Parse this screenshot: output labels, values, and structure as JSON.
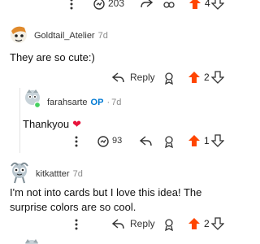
{
  "top_bar": {
    "views": "203",
    "votes": "4"
  },
  "comments": [
    {
      "username": "Goldtail_Atelier",
      "age": "7d",
      "text": "They are so cute:)",
      "reply_label": "Reply",
      "votes": "2"
    },
    {
      "username": "farahsarte",
      "op_badge": "OP",
      "separator": "·",
      "age": "7d",
      "text": "Thankyou",
      "heart": "❤",
      "views": "93",
      "votes": "1"
    },
    {
      "username": "kitkattter",
      "age": "7d",
      "text": "I'm not into cards but I love this idea! The surprise colors are so cool.",
      "reply_label": "Reply",
      "votes": "2"
    }
  ],
  "colors": {
    "upvote": "#ff4500",
    "heart": "#e8153c",
    "online": "#46d160"
  },
  "icons": [
    "more-icon",
    "view-count-icon",
    "share-icon",
    "award-icon",
    "upvote-icon",
    "downvote-icon",
    "reply-icon"
  ]
}
